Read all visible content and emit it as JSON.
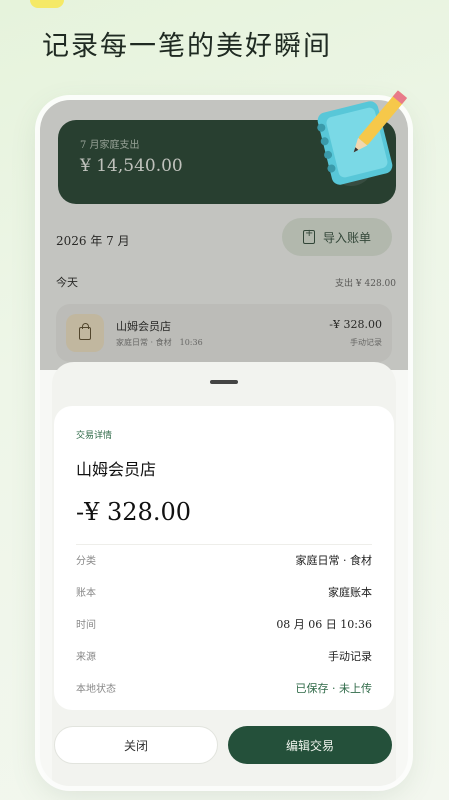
{
  "headline": "记录每一笔的美好瞬间",
  "summary": {
    "label": "7 月家庭支出",
    "amount": "¥ 14,540.00"
  },
  "month": "2026 年 7 月",
  "import_button": "导入账单",
  "today": {
    "label": "今天",
    "total": "支出 ¥ 428.00"
  },
  "transaction": {
    "name": "山姆会员店",
    "meta": "家庭日常 · 食材　10:36",
    "amount": "-¥ 328.00",
    "source": "手动记录"
  },
  "detail": {
    "kicker": "交易详情",
    "merchant": "山姆会员店",
    "amount": "-¥ 328.00",
    "rows": [
      {
        "key": "分类",
        "value": "家庭日常 · 食材"
      },
      {
        "key": "账本",
        "value": "家庭账本"
      },
      {
        "key": "时间",
        "value": "08 月 06 日 10:36"
      },
      {
        "key": "来源",
        "value": "手动记录"
      },
      {
        "key": "本地状态",
        "value": "已保存 · 未上传"
      }
    ]
  },
  "buttons": {
    "close": "关闭",
    "edit": "编辑交易"
  },
  "icons": [
    "import-icon",
    "shopping-bag-icon",
    "notebook-pencil-illustration"
  ],
  "colors": {
    "primary": "#24503a",
    "accent_green": "#2f6a48",
    "summary_card": "#20402f"
  }
}
